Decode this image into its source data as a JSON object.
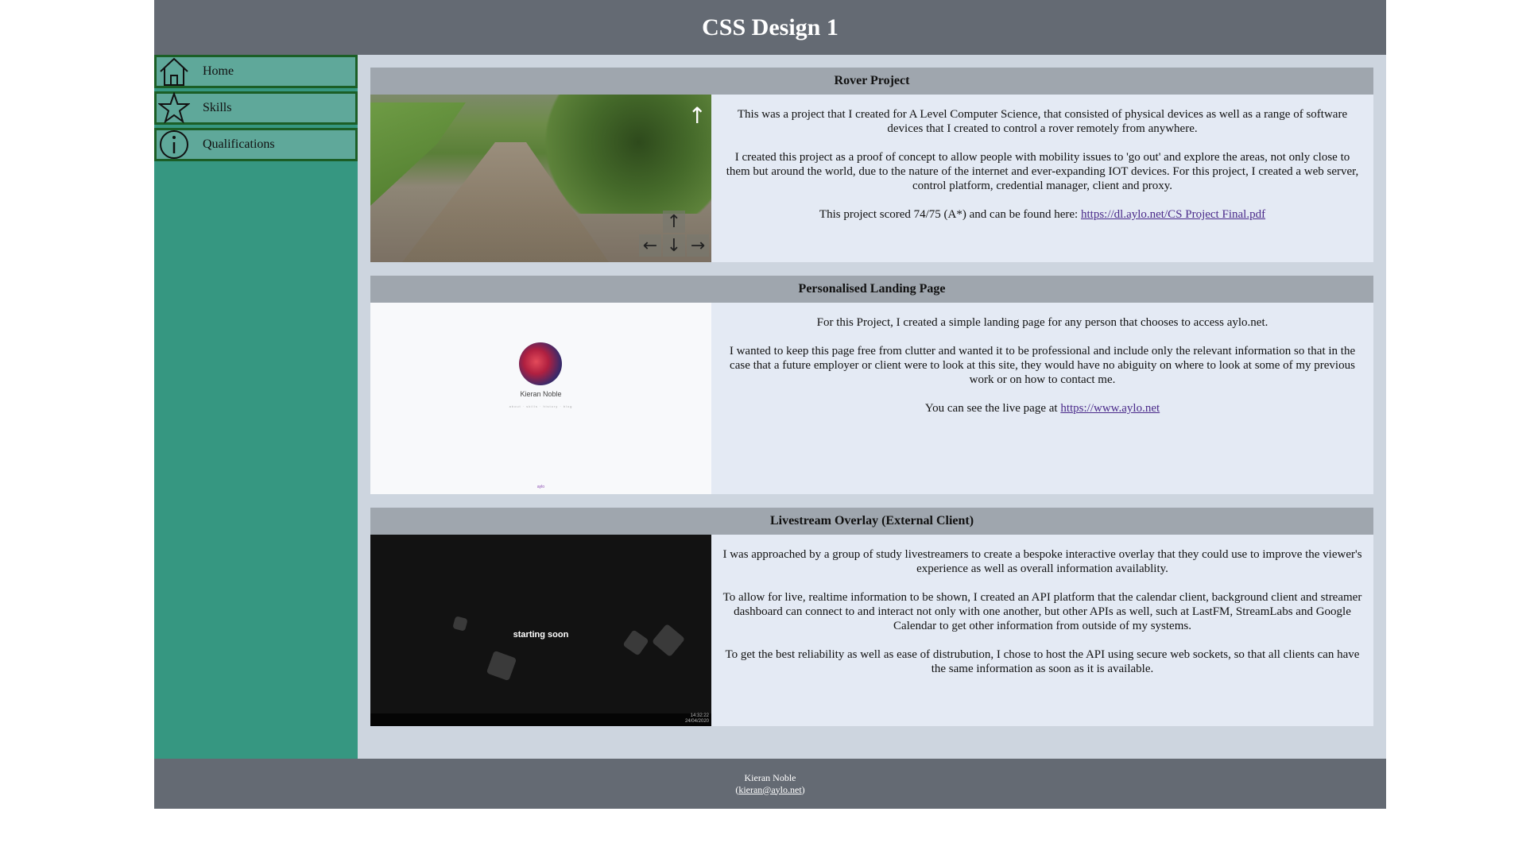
{
  "header": {
    "title": "CSS Design 1"
  },
  "nav": {
    "items": [
      {
        "label": "Home",
        "icon": "home-icon"
      },
      {
        "label": "Skills",
        "icon": "star-icon"
      },
      {
        "label": "Qualifications",
        "icon": "info-icon"
      }
    ]
  },
  "cards": [
    {
      "title": "Rover Project",
      "paragraphs": [
        "This was a project that I created for A Level Computer Science, that consisted of physical devices as well as a range of software devices that I created to control a rover remotely from anywhere.",
        "I created this project as a proof of concept to allow people with mobility issues to 'go out' and explore the areas, not only close to them but around the world, due to the nature of the internet and ever-expanding IOT devices. For this project, I created a web server, control platform, credential manager, client and proxy."
      ],
      "link_prefix": "This project scored 74/75 (A*) and can be found here: ",
      "link_text": "https://dl.aylo.net/CS Project Final.pdf",
      "link_suffix": ""
    },
    {
      "title": "Personalised Landing Page",
      "paragraphs": [
        "For this Project, I created a simple landing page for any person that chooses to access aylo.net.",
        "I wanted to keep this page free from clutter and wanted it to be professional and include only the relevant information so that in the case that a future employer or client were to look at this site, they would have no abiguity on where to look at some of my previous work or on how to contact me."
      ],
      "link_prefix": "You can see the live page at ",
      "link_text": "https://www.aylo.net",
      "link_suffix": "",
      "preview": {
        "name": "Kieran Noble",
        "links": "about · skills · history · blog",
        "footer": "aylo"
      }
    },
    {
      "title": "Livestream Overlay (External Client)",
      "paragraphs": [
        "I was approached by a group of study livestreamers to create a bespoke interactive overlay that they could use to improve the viewer's experience as well as overall information availablity.",
        "To allow for live, realtime information to be shown, I created an API platform that the calendar client, background client and streamer dashboard can connect to and interact not only with one another, but other APIs as well, such at LastFM, StreamLabs and Google Calendar to get other information from outside of my systems.",
        "To get the best reliability as well as ease of distrubution, I chose to host the API using secure web sockets, so that all clients can have the same information as soon as it is available."
      ],
      "preview": {
        "caption": "starting soon",
        "time": "14:32:22",
        "date": "24/04/2020"
      }
    }
  ],
  "footer": {
    "name": "Kieran Noble",
    "email": "kieran@aylo.net",
    "open_paren": "(",
    "close_paren": ")"
  }
}
